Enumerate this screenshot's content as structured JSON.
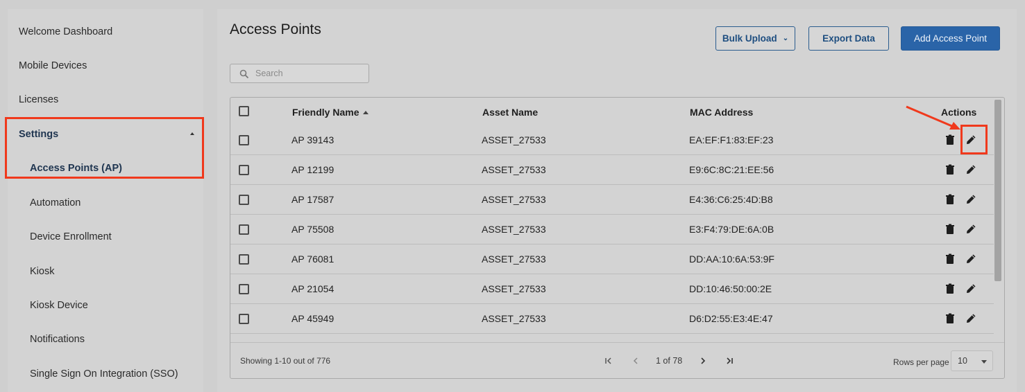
{
  "sidebar": {
    "items": [
      {
        "label": "Welcome Dashboard"
      },
      {
        "label": "Mobile Devices"
      },
      {
        "label": "Licenses"
      },
      {
        "label": "Settings"
      },
      {
        "label": "Access Points (AP)"
      },
      {
        "label": "Automation"
      },
      {
        "label": "Device Enrollment"
      },
      {
        "label": "Kiosk"
      },
      {
        "label": "Kiosk Device"
      },
      {
        "label": "Notifications"
      },
      {
        "label": "Single Sign On Integration (SSO)"
      }
    ]
  },
  "header": {
    "title": "Access Points",
    "bulk_upload_label": "Bulk Upload",
    "export_label": "Export Data",
    "add_label": "Add Access Point"
  },
  "search": {
    "placeholder": "Search"
  },
  "table": {
    "columns": [
      "Friendly Name",
      "Asset Name",
      "MAC Address",
      "Actions"
    ],
    "rows": [
      {
        "name": "AP  39143",
        "asset": "ASSET_27533",
        "mac": "EA:EF:F1:83:EF:23"
      },
      {
        "name": "AP  12199",
        "asset": "ASSET_27533",
        "mac": "E9:6C:8C:21:EE:56"
      },
      {
        "name": "AP  17587",
        "asset": "ASSET_27533",
        "mac": "E4:36:C6:25:4D:B8"
      },
      {
        "name": "AP  75508",
        "asset": "ASSET_27533",
        "mac": "E3:F4:79:DE:6A:0B"
      },
      {
        "name": "AP  76081",
        "asset": "ASSET_27533",
        "mac": "DD:AA:10:6A:53:9F"
      },
      {
        "name": "AP  21054",
        "asset": "ASSET_27533",
        "mac": "DD:10:46:50:00:2E"
      },
      {
        "name": "AP  45949",
        "asset": "ASSET_27533",
        "mac": "D6:D2:55:E3:4E:47"
      }
    ]
  },
  "footer": {
    "showing": "Showing 1-10 out of 776",
    "page": "1 of 78",
    "rows_per_page_label": "Rows per page",
    "rows_per_page_value": "10"
  },
  "colors": {
    "accent": "#2a64a8",
    "highlight": "#f0391c"
  }
}
